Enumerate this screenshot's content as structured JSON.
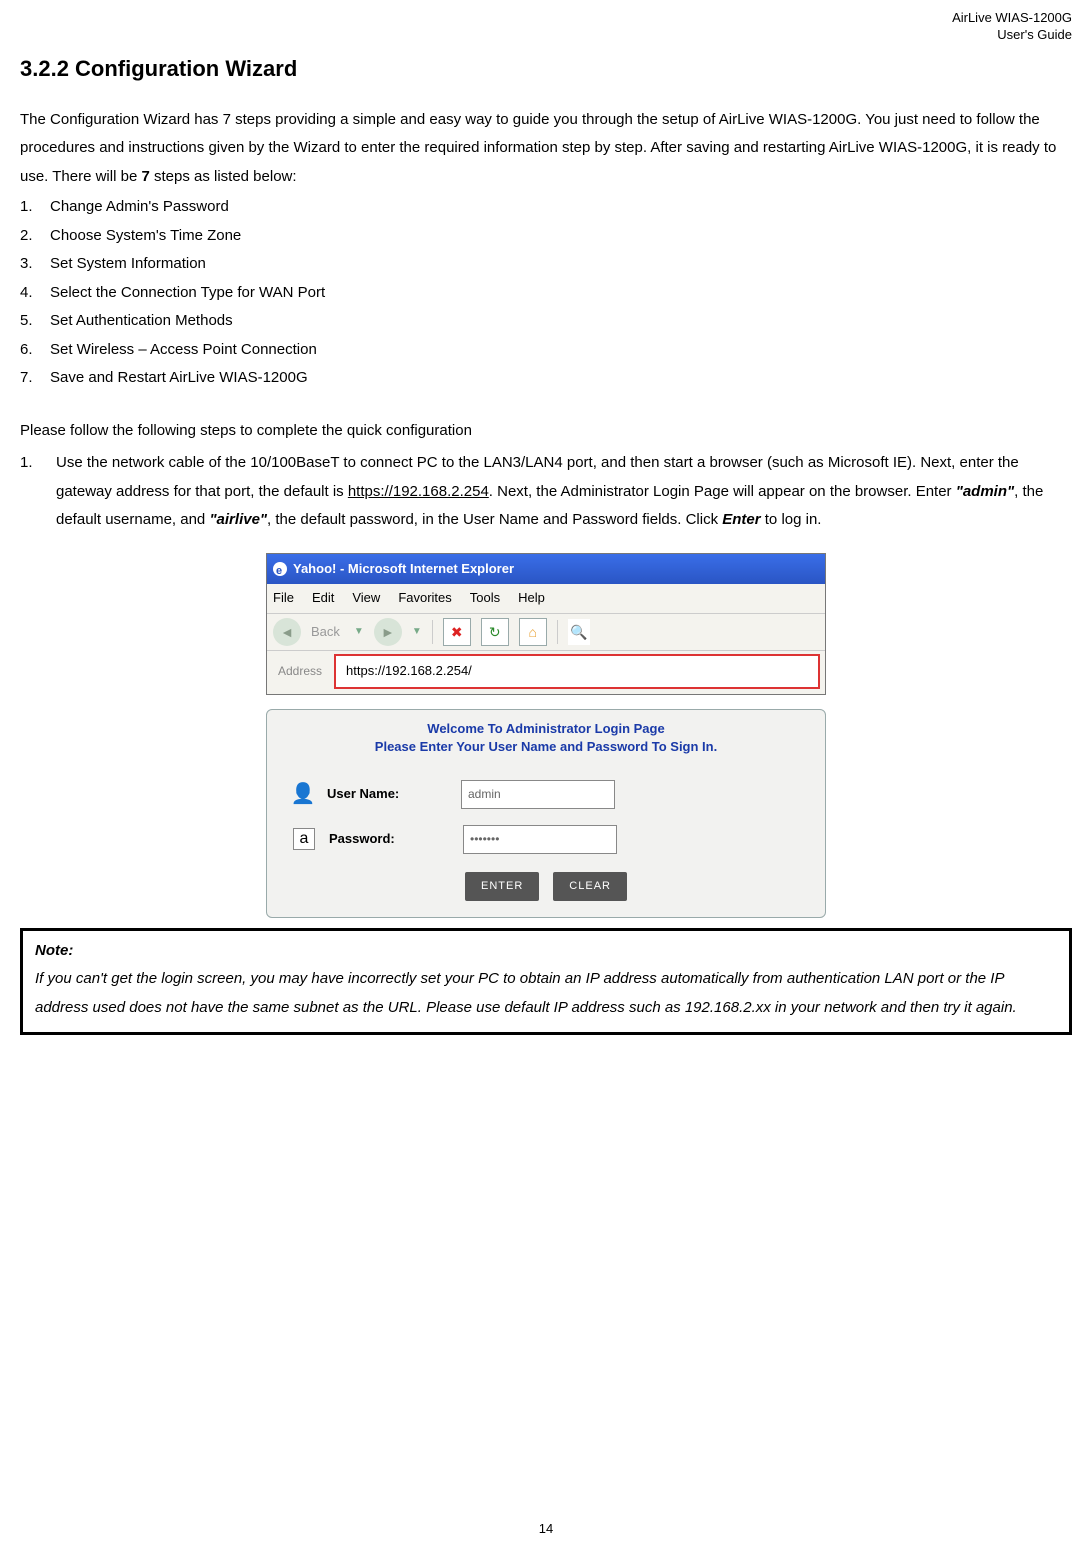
{
  "header": {
    "line1": "AirLive WIAS-1200G",
    "line2": "User's Guide"
  },
  "section_title": "3.2.2 Configuration Wizard",
  "intro_pre": "The Configuration Wizard has 7 steps providing a simple and easy way to guide you through the setup of AirLive WIAS-1200G. You just need to follow the procedures and instructions given by the Wizard to enter the required information step by step. After saving and restarting AirLive WIAS-1200G, it is ready to use. There will be ",
  "intro_bold": "7",
  "intro_post": " steps as listed below:",
  "steps": [
    {
      "n": "1.",
      "t": "Change Admin's Password"
    },
    {
      "n": "2.",
      "t": "Choose System's Time Zone"
    },
    {
      "n": "3.",
      "t": "Set System Information"
    },
    {
      "n": "4.",
      "t": "Select the Connection Type for WAN Port"
    },
    {
      "n": "5.",
      "t": "Set Authentication Methods"
    },
    {
      "n": "6.",
      "t": "Set Wireless – Access Point Connection"
    },
    {
      "n": "7.",
      "t": "Save and Restart AirLive WIAS-1200G"
    }
  ],
  "follow_line": "Please follow the following steps to complete the quick configuration",
  "big1": {
    "n": "1.",
    "a": "Use the network cable of the 10/100BaseT to connect PC to the LAN3/LAN4 port, and then start a browser (such as Microsoft IE). Next, enter the gateway address for that port, the default is ",
    "url": "https://192.168.2.254",
    "b": ". Next, the Administrator Login Page will appear on the browser. Enter ",
    "admin": "\"admin\"",
    "c": ", the default username, and ",
    "airlive": "\"airlive\"",
    "d": ", the default password, in the User Name and Password fields. Click ",
    "enter": "Enter",
    "e": " to log in."
  },
  "browser": {
    "title": "Yahoo! - Microsoft Internet Explorer",
    "menu": [
      "File",
      "Edit",
      "View",
      "Favorites",
      "Tools",
      "Help"
    ],
    "back_label": "Back",
    "address_label": "Address",
    "address_value": "https://192.168.2.254/"
  },
  "login": {
    "head1": "Welcome To Administrator Login Page",
    "head2": "Please Enter Your User Name and Password To Sign In.",
    "user_label": "User Name:",
    "user_value": "admin",
    "pass_label": "Password:",
    "pass_value": "•••••••",
    "btn_enter": "ENTER",
    "btn_clear": "CLEAR"
  },
  "note": {
    "title": "Note:",
    "body": "If you can't get the login screen, you may have incorrectly set your PC to obtain an IP address automatically from authentication LAN port or the IP address used does not have the same subnet as the URL. Please use default IP address such as 192.168.2.xx in your network and then try it again."
  },
  "page_number": "14"
}
